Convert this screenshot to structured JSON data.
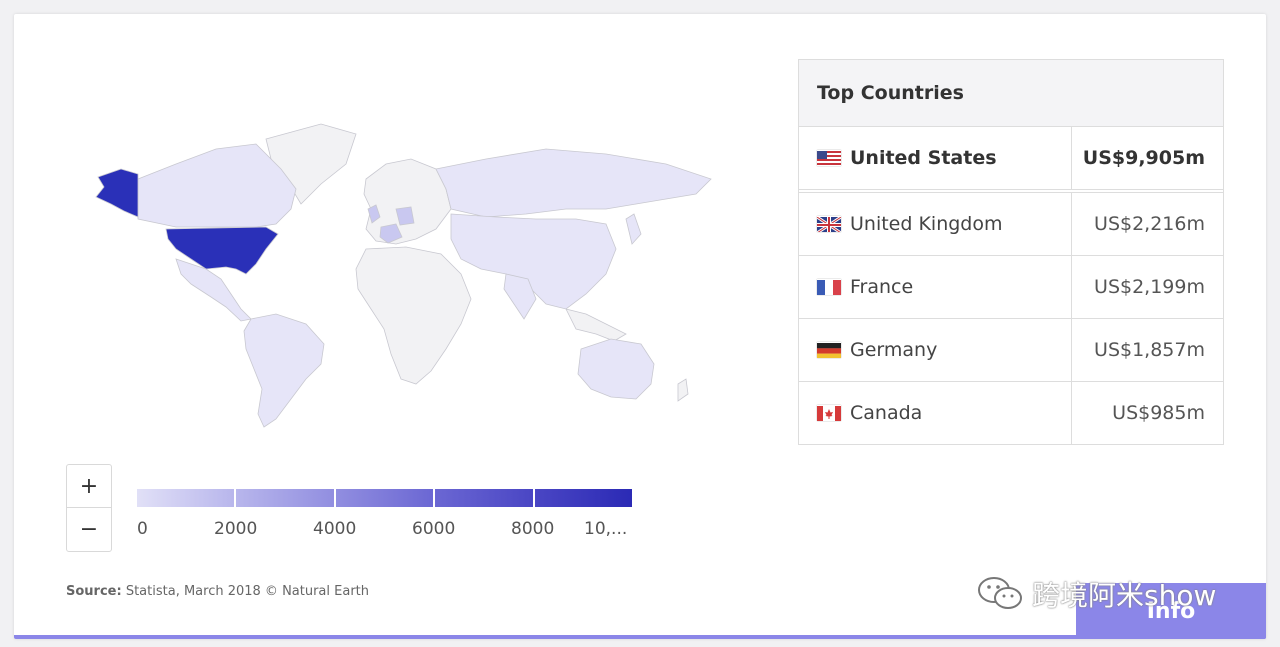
{
  "map": {
    "colors": {
      "us": "#2a30b8",
      "low": "#e6e5f8",
      "mid": "#c9c8f0",
      "none": "#f2f2f4",
      "border": "#c8c8d0"
    }
  },
  "zoom": {
    "in_label": "+",
    "out_label": "−"
  },
  "legend": {
    "labels": [
      "0",
      "2000",
      "4000",
      "6000",
      "8000",
      "10,..."
    ],
    "colors": [
      "#e1e0f7",
      "#b8b6ec",
      "#918ee0",
      "#6b67d3",
      "#4a46c4",
      "#2b2ab5"
    ]
  },
  "source": {
    "label": "Source:",
    "text": "Statista, March 2018 © Natural Earth"
  },
  "top_countries": {
    "title": "Top Countries",
    "rows": [
      {
        "country": "United States",
        "value": "US$9,905m",
        "flag": "us-flag-icon"
      },
      {
        "country": "United Kingdom",
        "value": "US$2,216m",
        "flag": "uk-flag-icon"
      },
      {
        "country": "France",
        "value": "US$2,199m",
        "flag": "france-flag-icon"
      },
      {
        "country": "Germany",
        "value": "US$1,857m",
        "flag": "germany-flag-icon"
      },
      {
        "country": "Canada",
        "value": "US$985m",
        "flag": "canada-flag-icon"
      }
    ]
  },
  "info_button": {
    "label": "Info"
  },
  "watermark": {
    "text": "跨境阿米show"
  }
}
